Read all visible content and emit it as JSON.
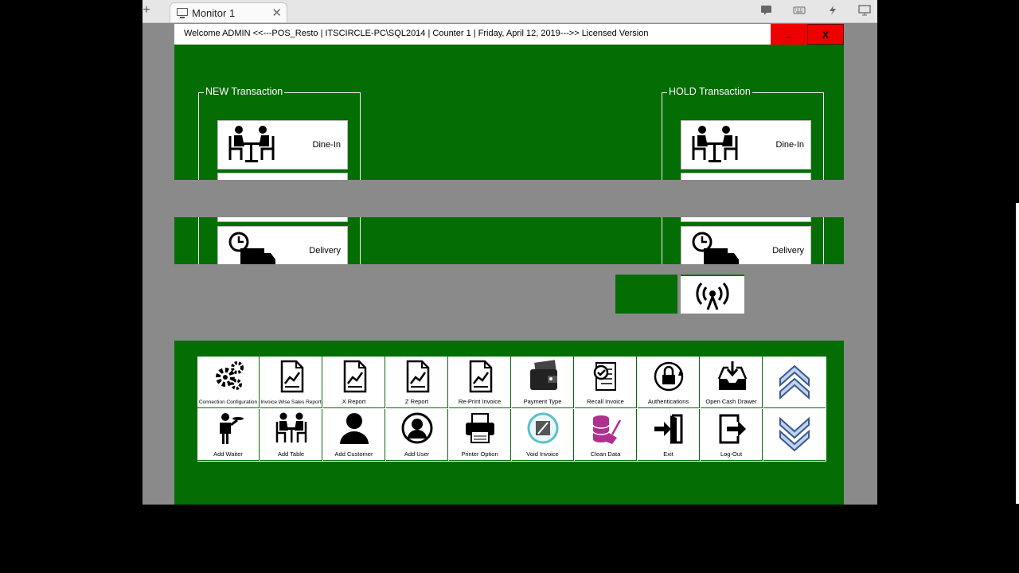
{
  "browser": {
    "tab_title": "Monitor 1",
    "tab_close": "✕",
    "new_tab": "+"
  },
  "app": {
    "title": "Welcome ADMIN <<---POS_Resto | ITSCIRCLE-PC\\SQL2014 | Counter 1 | Friday, April 12, 2019--->> Licensed Version",
    "minimize_label": "_",
    "close_label": "X",
    "new_group": {
      "title": "NEW Transaction",
      "items": [
        {
          "label": "Dine-In"
        },
        {
          "label": "Delivery"
        }
      ]
    },
    "hold_group": {
      "title": "HOLD Transaction",
      "items": [
        {
          "label": "Dine-In"
        },
        {
          "label": "Delivery"
        }
      ]
    },
    "toolbar_top": [
      {
        "label": "Connection Configuration",
        "icon": "gears-icon"
      },
      {
        "label": "Invoice Wise Sales Report",
        "icon": "report-icon"
      },
      {
        "label": "X Report",
        "icon": "report-icon"
      },
      {
        "label": "Z Report",
        "icon": "report-icon"
      },
      {
        "label": "Re-Print Invoice",
        "icon": "report-icon"
      },
      {
        "label": "Payment Type",
        "icon": "wallet-icon"
      },
      {
        "label": "Recall Invoice",
        "icon": "recall-icon"
      },
      {
        "label": "Authentications",
        "icon": "lock-icon"
      },
      {
        "label": "Open Cash Drawer",
        "icon": "drawer-icon"
      },
      {
        "label": "",
        "icon": "chevron-up-icon"
      }
    ],
    "toolbar_bottom": [
      {
        "label": "Add Waiter",
        "icon": "waiter-icon"
      },
      {
        "label": "Add Table",
        "icon": "table-icon"
      },
      {
        "label": "Add Customer",
        "icon": "customer-icon"
      },
      {
        "label": "Add User",
        "icon": "user-icon"
      },
      {
        "label": "Printer Option",
        "icon": "printer-icon"
      },
      {
        "label": "Void Invoice",
        "icon": "void-icon"
      },
      {
        "label": "Clean  Data",
        "icon": "clean-icon"
      },
      {
        "label": "Exit",
        "icon": "exit-icon"
      },
      {
        "label": "Log-Out",
        "icon": "logout-icon"
      },
      {
        "label": "",
        "icon": "chevron-down-icon"
      }
    ]
  },
  "colors": {
    "app_bg": "#046d04",
    "close_red": "#ee0000",
    "chevron_blue": "#3a5a8c"
  }
}
